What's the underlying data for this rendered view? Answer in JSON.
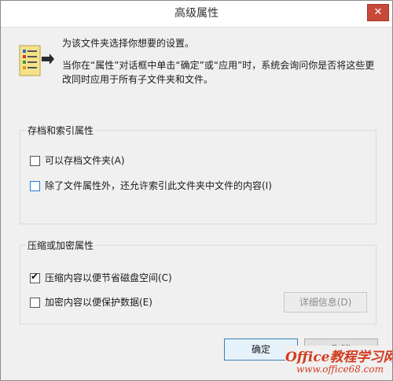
{
  "dialog": {
    "title": "高级属性",
    "close_glyph": "✕",
    "icon": "folder-properties-icon",
    "header": {
      "line1": "为该文件夹选择你想要的设置。",
      "line2": "当你在“属性”对话框中单击“确定”或“应用”时，系统会询问你是否将这些更改同时应用于所有子文件夹和文件。"
    },
    "archive_group": {
      "title": "存档和索引属性",
      "items": [
        {
          "label": "可以存档文件夹(A)",
          "checked": false
        },
        {
          "label": "除了文件属性外，还允许索引此文件夹中文件的内容(I)",
          "checked": false
        }
      ]
    },
    "compress_group": {
      "title": "压缩或加密属性",
      "items": [
        {
          "label": "压缩内容以便节省磁盘空间(C)",
          "checked": true
        },
        {
          "label": "加密内容以便保护数据(E)",
          "checked": false
        }
      ],
      "details_label": "详细信息(D)"
    },
    "ok_label": "确定",
    "cancel_label": "取消"
  },
  "watermark": {
    "main": "Office教程学习网",
    "url": "www.office68.com"
  },
  "colors": {
    "window_bg": "#f0f0f0",
    "close_red": "#c7493a",
    "default_button_border": "#3c7fb1",
    "focus_checkbox_border": "#2a7fd4",
    "watermark_red": "#d23b1f"
  }
}
